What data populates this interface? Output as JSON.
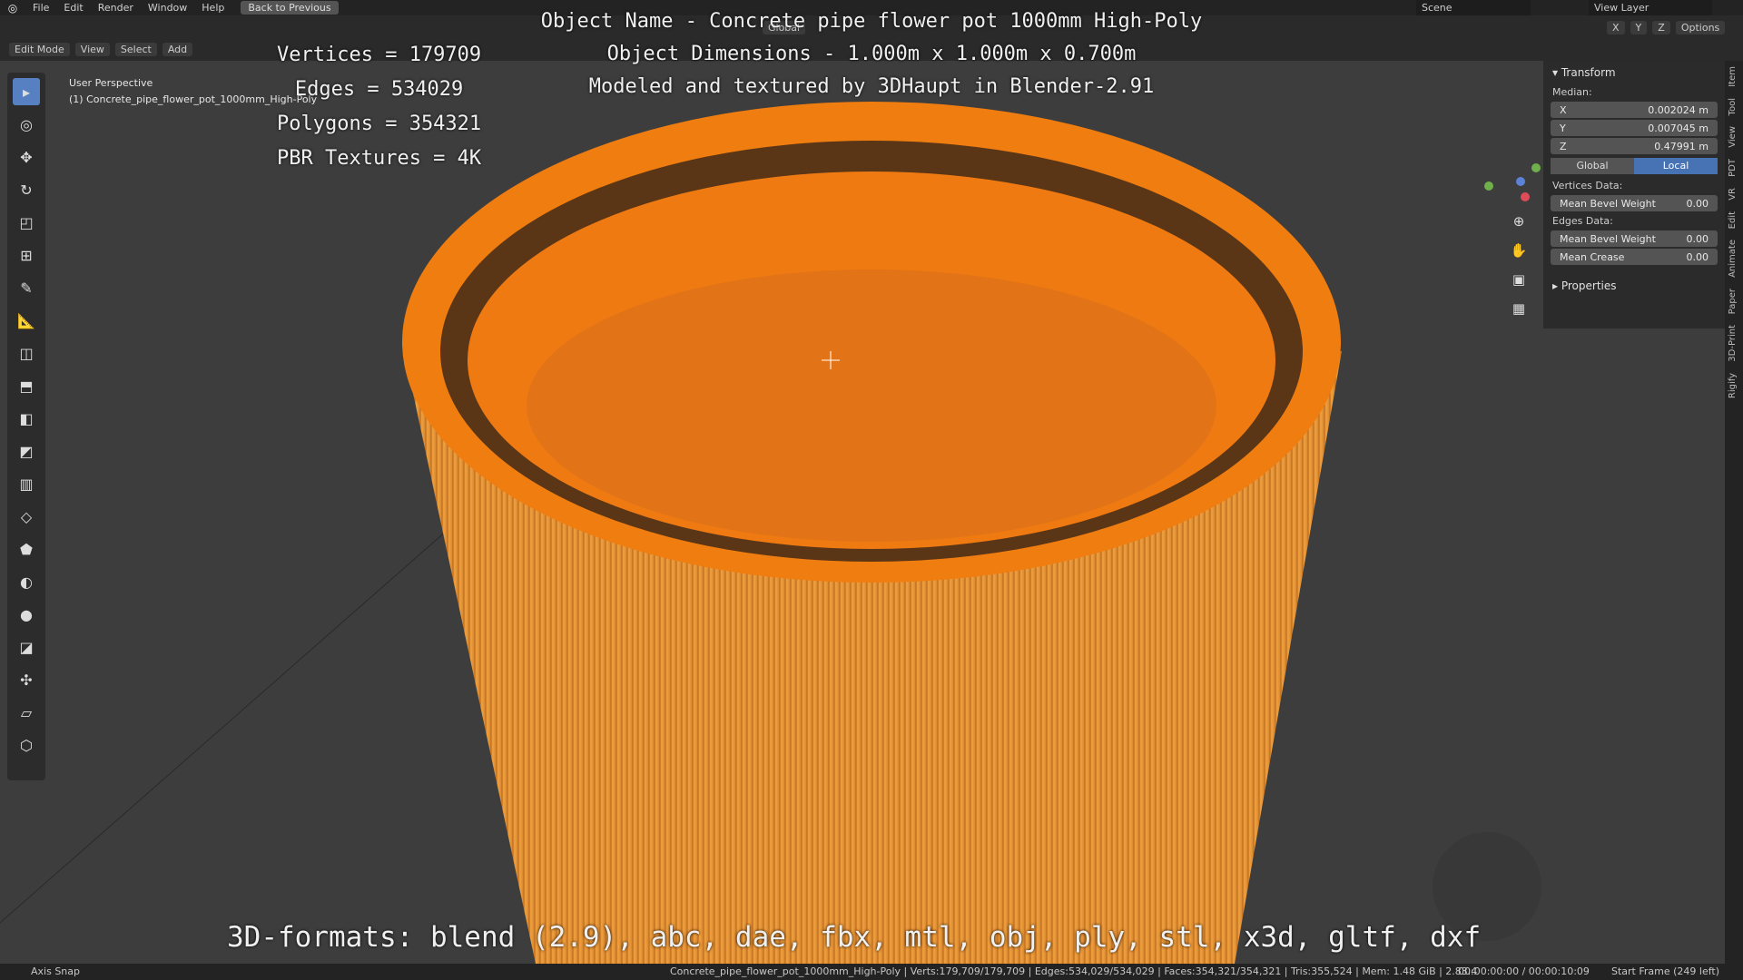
{
  "topbar": {
    "menus": [
      "File",
      "Edit",
      "Render",
      "Window",
      "Help"
    ],
    "back_button": "Back to Previous",
    "scene": "Scene",
    "view_layer": "View Layer"
  },
  "header": {
    "mode": "Edit Mode",
    "menus": [
      "View",
      "Select",
      "Add"
    ],
    "orientation": "Global",
    "options_label": "Options",
    "axis_labels": [
      "X",
      "Y",
      "Z"
    ]
  },
  "viewport": {
    "perspective": "User Perspective",
    "object_label": "(1) Concrete_pipe_flower_pot_1000mm_High-Poly"
  },
  "overlay": {
    "stats": [
      "Vertices = 179709",
      "Edges = 534029",
      "Polygons = 354321",
      "PBR Textures = 4K"
    ],
    "title_lines": [
      "Object Name - Concrete pipe flower pot 1000mm High-Poly",
      "Object Dimensions -  1.000m x 1.000m x 0.700m",
      "Modeled and textured by 3DHaupt in Blender-2.91"
    ],
    "formats": "3D-formats: blend (2.9), abc, dae, fbx, mtl, obj, ply, stl, x3d, gltf, dxf"
  },
  "npanel": {
    "section": "Transform",
    "median_label": "Median:",
    "x_label": "X",
    "x_value": "0.002024 m",
    "y_label": "Y",
    "y_value": "0.007045 m",
    "z_label": "Z",
    "z_value": "0.47991 m",
    "global": "Global",
    "local": "Local",
    "vertices_data": "Vertices Data:",
    "mean_bevel_weight": "Mean Bevel Weight",
    "vbw_value": "0.00",
    "edges_data": "Edges Data:",
    "ebw_label": "Mean Bevel Weight",
    "ebw_value": "0.00",
    "mean_crease": "Mean Crease",
    "crease_value": "0.00",
    "properties": "Properties"
  },
  "sidetabs": [
    "Item",
    "Tool",
    "View",
    "PDT",
    "VR",
    "Edit",
    "Animate",
    "Paper",
    "3D-Print",
    "Rigify"
  ],
  "status": {
    "left": "Axis Snap",
    "stats": "Concrete_pipe_flower_pot_1000mm_High-Poly | Verts:179,709/179,709 | Edges:534,029/534,029 | Faces:354,321/354,321 | Tris:355,524 | Mem: 1.48 GiB | 2.83.4",
    "time": "00:00:00:00 / 00:00:10:09",
    "frame": "Start Frame (249 left)"
  },
  "colors": {
    "accent": "#4772b3",
    "mesh": "#f07d10"
  }
}
